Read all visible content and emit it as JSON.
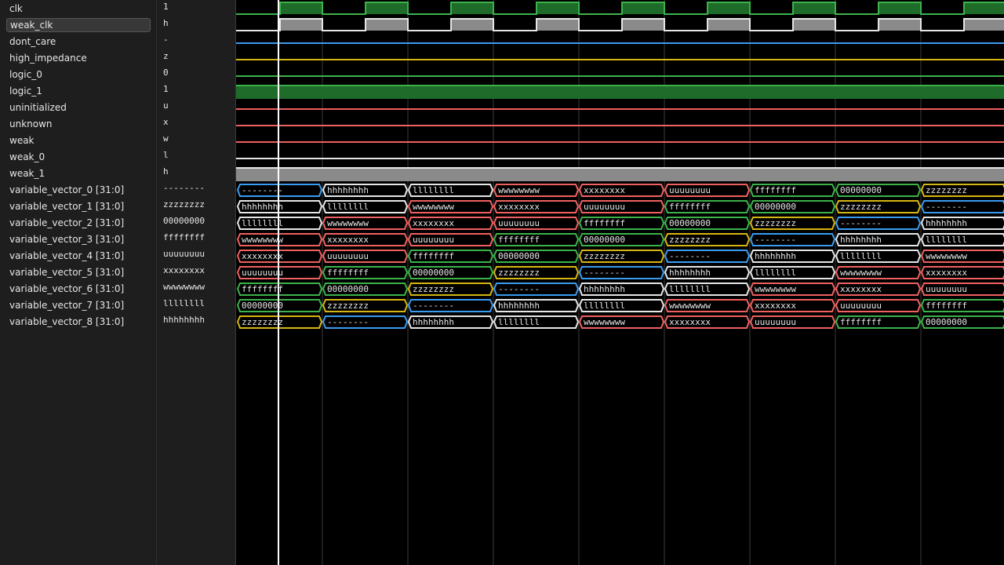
{
  "signals": [
    {
      "name": "clk",
      "value": "1",
      "kind": "clock",
      "color": "#3bb34a"
    },
    {
      "name": "weak_clk",
      "value": "h",
      "kind": "weakclock",
      "color": "#e6e6e6",
      "selected": true
    },
    {
      "name": "dont_care",
      "value": "-",
      "kind": "line",
      "color": "#3a9cf0"
    },
    {
      "name": "high_impedance",
      "value": "z",
      "kind": "line",
      "color": "#d6b612"
    },
    {
      "name": "logic_0",
      "value": "0",
      "kind": "line",
      "color": "#3bb34a"
    },
    {
      "name": "logic_1",
      "value": "1",
      "kind": "high",
      "color": "#3bb34a"
    },
    {
      "name": "uninitialized",
      "value": "u",
      "kind": "line",
      "color": "#f06060"
    },
    {
      "name": "unknown",
      "value": "x",
      "kind": "line",
      "color": "#f06060"
    },
    {
      "name": "weak",
      "value": "w",
      "kind": "line",
      "color": "#f06060"
    },
    {
      "name": "weak_0",
      "value": "l",
      "kind": "line",
      "color": "#e6e6e6"
    },
    {
      "name": "weak_1",
      "value": "h",
      "kind": "high",
      "color": "#e6e6e6"
    },
    {
      "name": "variable_vector_0 [31:0]",
      "value": "--------",
      "kind": "vector",
      "offset": 0
    },
    {
      "name": "variable_vector_1 [31:0]",
      "value": "zzzzzzzz",
      "kind": "vector",
      "offset": 1
    },
    {
      "name": "variable_vector_2 [31:0]",
      "value": "00000000",
      "kind": "vector",
      "offset": 2
    },
    {
      "name": "variable_vector_3 [31:0]",
      "value": "ffffffff",
      "kind": "vector",
      "offset": 3
    },
    {
      "name": "variable_vector_4 [31:0]",
      "value": "uuuuuuuu",
      "kind": "vector",
      "offset": 4
    },
    {
      "name": "variable_vector_5 [31:0]",
      "value": "xxxxxxxx",
      "kind": "vector",
      "offset": 5
    },
    {
      "name": "variable_vector_6 [31:0]",
      "value": "wwwwwwww",
      "kind": "vector",
      "offset": 6
    },
    {
      "name": "variable_vector_7 [31:0]",
      "value": "llllllll",
      "kind": "vector",
      "offset": 7
    },
    {
      "name": "variable_vector_8 [31:0]",
      "value": "hhhhhhhh",
      "kind": "vector",
      "offset": 8
    }
  ],
  "vector_cycle": [
    {
      "text": "--------",
      "color": "#3a9cf0"
    },
    {
      "text": "hhhhhhhh",
      "color": "#e6e6e6"
    },
    {
      "text": "llllllll",
      "color": "#e6e6e6"
    },
    {
      "text": "wwwwwwww",
      "color": "#f06060"
    },
    {
      "text": "xxxxxxxx",
      "color": "#f06060"
    },
    {
      "text": "uuuuuuuu",
      "color": "#f06060"
    },
    {
      "text": "ffffffff",
      "color": "#3bb34a"
    },
    {
      "text": "00000000",
      "color": "#3bb34a"
    },
    {
      "text": "zzzzzzzz",
      "color": "#d6b612"
    }
  ],
  "colors": {
    "clock_fill": "#1e6b2a",
    "weak_fill": "#8a8a8a",
    "gridline": "#3c3c3c",
    "cursor": "#ffffff",
    "wave_background": "#000000"
  }
}
